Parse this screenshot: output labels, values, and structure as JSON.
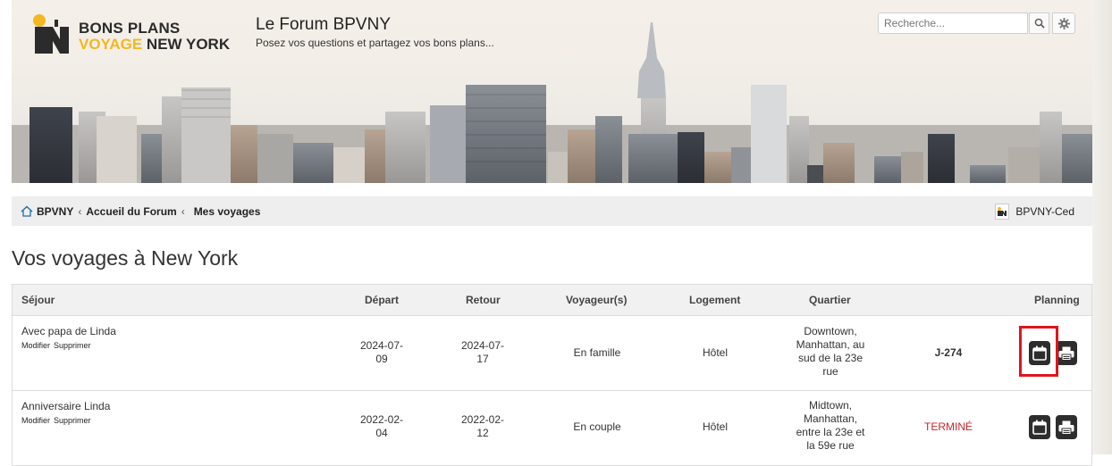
{
  "header": {
    "logo_line1": "BONS PLANS",
    "logo_line2_a": "VOYAGE",
    "logo_line2_b": "NEW YORK",
    "site_title": "Le Forum BPVNY",
    "site_desc": "Posez vos questions et partagez vos bons plans...",
    "search_placeholder": "Recherche..."
  },
  "breadcrumb": {
    "items": [
      "BPVNY",
      "Accueil du Forum",
      "Mes voyages"
    ],
    "separator": "‹"
  },
  "user": {
    "name": "BPVNY-Ced"
  },
  "page_title": "Vos voyages à New York",
  "table": {
    "headers": {
      "sejour": "Séjour",
      "depart": "Départ",
      "retour": "Retour",
      "voyageurs": "Voyageur(s)",
      "logement": "Logement",
      "quartier": "Quartier",
      "planning": "Planning"
    },
    "rows": [
      {
        "name": "Avec papa de Linda",
        "edit": "Modifier",
        "delete": "Supprimer",
        "depart_a": "2024-07-",
        "depart_b": "09",
        "retour_a": "2024-07-",
        "retour_b": "17",
        "voyageurs": "En famille",
        "logement": "Hôtel",
        "quartier": [
          "Downtown,",
          "Manhattan, au",
          "sud de la 23e",
          "rue"
        ],
        "status": "J-274"
      },
      {
        "name": "Anniversaire Linda",
        "edit": "Modifier",
        "delete": "Supprimer",
        "depart_a": "2022-02-",
        "depart_b": "04",
        "retour_a": "2022-02-",
        "retour_b": "12",
        "voyageurs": "En couple",
        "logement": "Hôtel",
        "quartier": [
          "Midtown,",
          "Manhattan,",
          "entre la 23e et",
          "la 59e rue"
        ],
        "status": "TERMINÉ"
      }
    ]
  },
  "colors": {
    "accent_yellow": "#f3b81e",
    "done_red": "#c9252c",
    "highlight_red": "#e0151c",
    "button_dark": "#2d2d2d"
  },
  "icons": [
    "home-icon",
    "search-icon",
    "gear-icon",
    "calendar-icon",
    "print-icon"
  ]
}
